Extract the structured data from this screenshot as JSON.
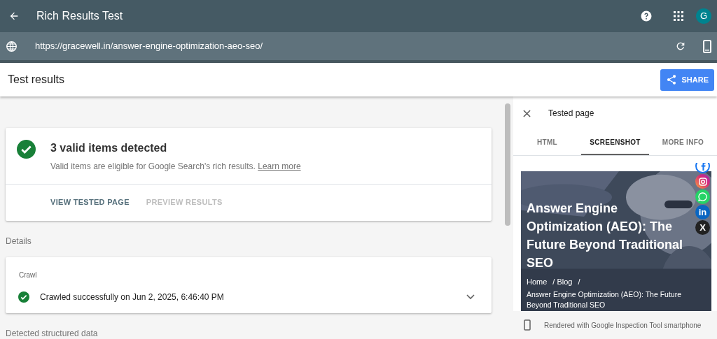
{
  "app_bar": {
    "title": "Rich Results Test",
    "avatar": "G"
  },
  "url_bar": {
    "value": "https://gracewell.in/answer-engine-optimization-aeo-seo/"
  },
  "header": {
    "title": "Test results",
    "share_button": "SHARE"
  },
  "summary_card": {
    "title": "3 valid items detected",
    "description": "Valid items are eligible for Google Search's rich results.",
    "link": "Learn more",
    "actions": [
      {
        "label": "VIEW TESTED PAGE",
        "disabled": false
      },
      {
        "label": "PREVIEW RESULTS",
        "disabled": true
      }
    ]
  },
  "details_label": "Details",
  "crawl_card": {
    "label": "Crawl",
    "status": "Crawled successfully on Jun 2, 2025, 6:46:40 PM",
    "expanded": false
  },
  "structured_data_label": "Detected structured data",
  "side_panel": {
    "title": "Tested page",
    "tabs": [
      {
        "label": "HTML",
        "selected": false
      },
      {
        "label": "SCREENSHOT",
        "selected": true
      },
      {
        "label": "MORE INFO",
        "selected": false
      }
    ],
    "preview": {
      "heading": "Answer Engine Optimization (AEO): The Future Beyond Traditional SEO",
      "breadcrumbs": [
        "Home",
        "/ Blog",
        "/"
      ],
      "breadcrumb_current": "Answer Engine Optimization (AEO): The Future Beyond Traditional SEO",
      "social_icons": [
        {
          "kind": "facebook"
        },
        {
          "kind": "instagram"
        },
        {
          "kind": "whatsapp"
        },
        {
          "kind": "linkedin",
          "label": "in"
        },
        {
          "kind": "x",
          "label": "X"
        }
      ]
    },
    "footer": "Rendered with Google Inspection Tool smartphone"
  }
}
